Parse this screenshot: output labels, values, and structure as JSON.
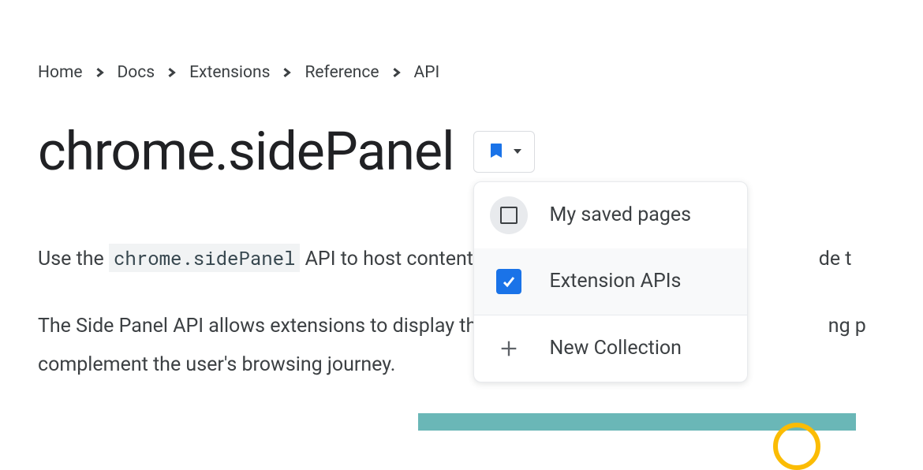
{
  "breadcrumb": {
    "items": [
      "Home",
      "Docs",
      "Extensions",
      "Reference",
      "API"
    ]
  },
  "page": {
    "title": "chrome.sidePanel"
  },
  "body": {
    "intro_pre": "Use the ",
    "intro_code": "chrome.sidePanel",
    "intro_post": " API to host content in the b",
    "intro_tail": "de t",
    "para2_line1": "The Side Panel API allows extensions to display their owr",
    "para2_tail1": "ng p",
    "para2_line2": "complement the user's browsing journey."
  },
  "dropdown": {
    "items": [
      {
        "label": "My saved pages",
        "checked": false
      },
      {
        "label": "Extension APIs",
        "checked": true
      }
    ],
    "new_label": "New Collection"
  }
}
